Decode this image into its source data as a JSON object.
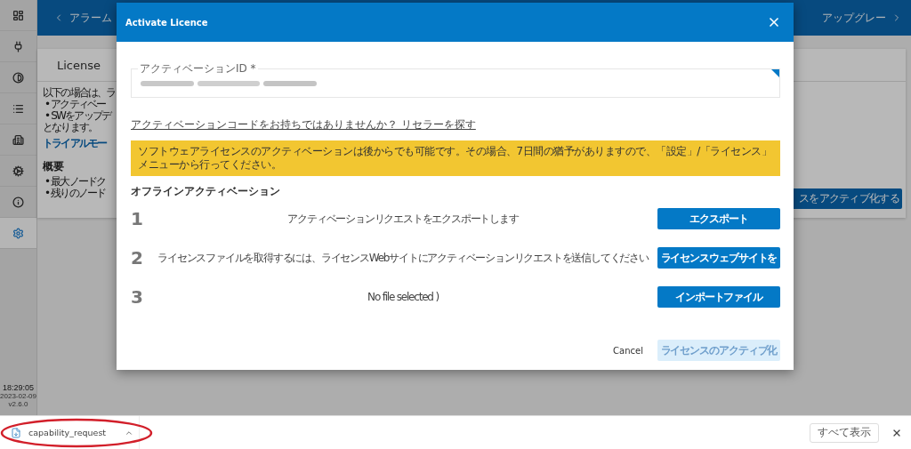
{
  "sidebar": {
    "items": [
      {
        "kind": "dashboard",
        "selected": false
      },
      {
        "kind": "plug",
        "selected": false
      },
      {
        "kind": "contrast",
        "selected": false
      },
      {
        "kind": "list",
        "selected": false
      },
      {
        "kind": "building",
        "selected": false
      },
      {
        "kind": "gears",
        "selected": false
      },
      {
        "kind": "info",
        "selected": false
      },
      {
        "kind": "settings",
        "selected": true
      }
    ],
    "time": "18:29:05",
    "date": "2023-02-09",
    "version": "v2.6.0"
  },
  "top_bar": {
    "left_label": "アラーム",
    "right_label": "アップグレー"
  },
  "license_card": {
    "title": "License",
    "intro": "以下の場合は、ラ",
    "bullets": [
      "• アクティベー",
      "• SWをアップデ"
    ],
    "outro": "となります。",
    "link": "トライアルモー",
    "section": "概要",
    "summary": [
      "• 最大ノードク",
      "• 残りのノード"
    ],
    "button": "スをアクティブ化する"
  },
  "dialog": {
    "title": "Activate Licence",
    "field_label": "アクティベーションID *",
    "reseller_link": "アクティベーションコードをお持ちではありませんか？ リセラーを探す",
    "notice": "ソフトウェアライセンスのアクティベーションは後からでも可能です。その場合、7日間の猶予がありますので、「設定」/「ライセンス」メニューから行ってください。",
    "section": "オフラインアクティベーション",
    "steps": [
      {
        "number": "1",
        "text": "アクティベーションリクエストをエクスポートします",
        "button": "エクスポート"
      },
      {
        "number": "2",
        "text": "ライセンスファイルを取得するには、ライセンスWebサイトにアクティベーションリクエストを送信してください",
        "button": "ライセンスウェブサイトを"
      },
      {
        "number": "3",
        "text": "No file selected )",
        "button": "インポートファイル"
      }
    ],
    "cancel": "Cancel",
    "activate": {
      "label": "ライセンスのアクティブ化",
      "disabled": true
    }
  },
  "download_bar": {
    "file": "capability_request",
    "show_all": "すべて表示"
  }
}
